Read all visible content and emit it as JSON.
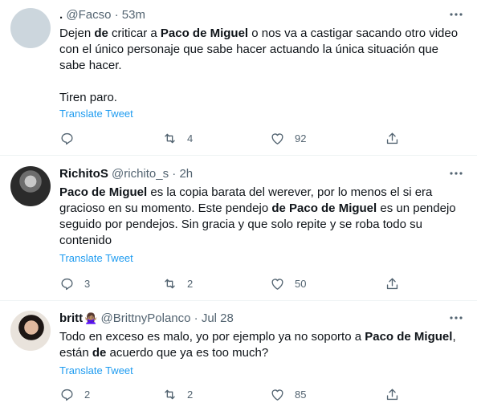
{
  "tweets": [
    {
      "name": ".",
      "handle": "@Facso",
      "separator": "·",
      "time": "53m",
      "line1_a": "Dejen ",
      "line1_b": "de",
      "line1_c": " criticar a ",
      "line1_d": "Paco de Miguel",
      "line1_e": " o nos va a castigar sacando otro video",
      "line2": "con el único personaje que sabe hacer actuando la única situación que",
      "line3": "sabe hacer.",
      "line4": "Tiren paro.",
      "translate": "Translate Tweet",
      "replies": "",
      "retweets": "4",
      "likes": "92"
    },
    {
      "name": "RichitoS",
      "handle": "@richito_s",
      "separator": "·",
      "time": "2h",
      "l1_a": "Paco de Miguel",
      "l1_b": " es la copia barata del werever, por lo menos el si era",
      "l2_a": "gracioso en su momento. Este pendejo ",
      "l2_b": "de Paco de Miguel",
      "l2_c": " es un pendejo",
      "l3": "seguido por pendejos. Sin gracia y que solo repite y se roba todo su",
      "l4": "contenido",
      "translate": "Translate Tweet",
      "replies": "3",
      "retweets": "2",
      "likes": "50"
    },
    {
      "name": "britt",
      "handle": "@BrittnyPolanco",
      "separator": "·",
      "time": "Jul 28",
      "l1_a": "Todo en exceso es malo, yo por ejemplo ya no soporto a ",
      "l1_b": "Paco de Miguel",
      "l1_c": ",",
      "l2_a": "están ",
      "l2_b": "de",
      "l2_c": " acuerdo que ya es too much?",
      "translate": "Translate Tweet",
      "replies": "2",
      "retweets": "2",
      "likes": "85"
    }
  ],
  "icons": [
    "reply-icon",
    "retweet-icon",
    "like-icon",
    "share-icon",
    "more-icon"
  ]
}
